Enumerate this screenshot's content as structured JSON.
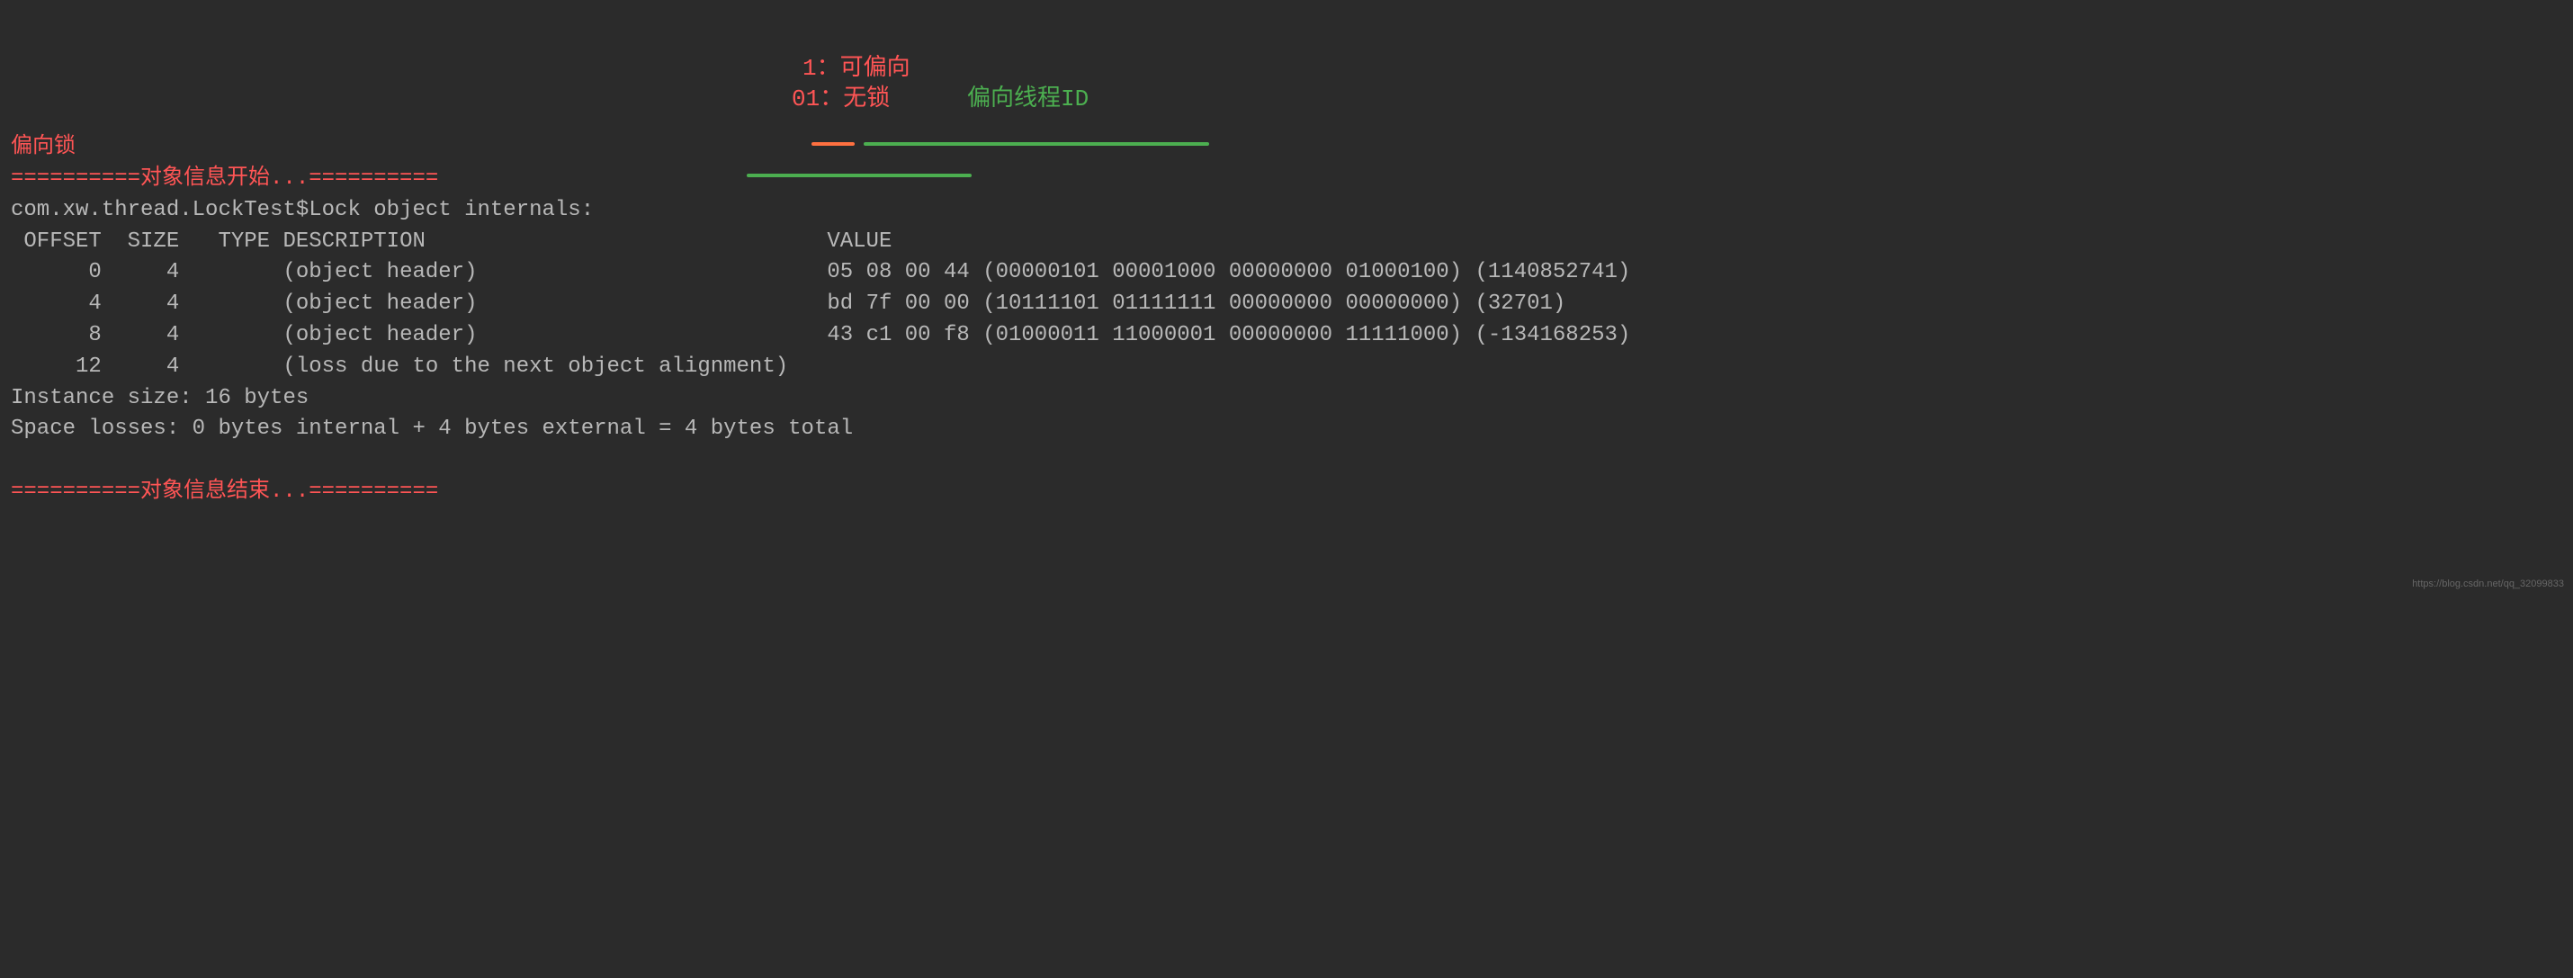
{
  "header": {
    "lock_type": "偏向锁",
    "start_marker": "==========对象信息开始...==========",
    "class_line": "com.xw.thread.LockTest$Lock object internals:"
  },
  "columns": " OFFSET  SIZE   TYPE DESCRIPTION                               VALUE",
  "rows": [
    {
      "offset_size": "      0     4        (object header)                           ",
      "value_hex": "05 08 00 44 ",
      "binary": "(00000101 00001000 00000000 01000100) ",
      "decimal": "(1140852741)"
    },
    {
      "offset_size": "      4     4        (object header)                           ",
      "value_hex": "bd 7f 00 00 ",
      "binary": "(10111101 01111111 00000000 00000000) ",
      "decimal": "(32701)"
    },
    {
      "offset_size": "      8     4        (object header)                           ",
      "value_hex": "43 c1 00 f8 ",
      "binary": "(01000011 11000001 00000000 11111000) ",
      "decimal": "(-134168253)"
    },
    {
      "offset_size": "     12     4        (loss due to the next object alignment)",
      "value_hex": "",
      "binary": "",
      "decimal": ""
    }
  ],
  "footer": {
    "instance_size": "Instance size: 16 bytes",
    "space_losses": "Space losses: 0 bytes internal + 4 bytes external = 4 bytes total",
    "end_marker": "==========对象信息结束...=========="
  },
  "annotations": {
    "biasable": "1：可偏向",
    "no_lock": "01：无锁",
    "thread_id": "偏向线程ID"
  },
  "watermark": "https://blog.csdn.net/qq_32099833"
}
